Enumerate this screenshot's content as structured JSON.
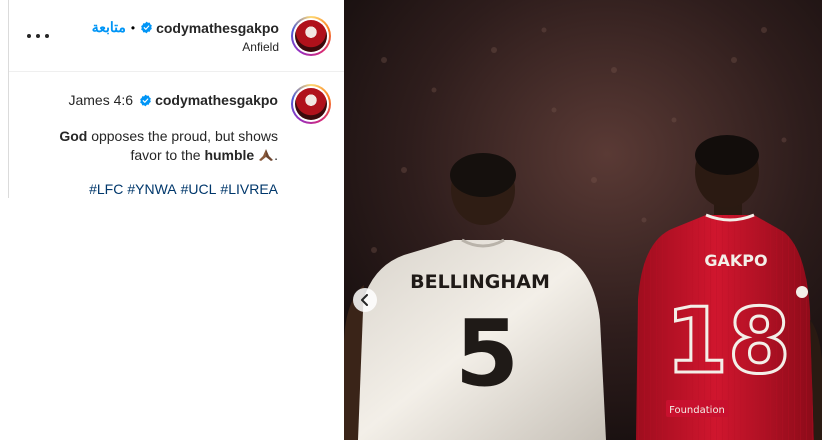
{
  "header": {
    "username": "codymathesgakpo",
    "follow_label": "متابعة",
    "separator": "•",
    "location": "Anfield"
  },
  "caption": {
    "verse": "James 4:6",
    "username": "codymathesgakpo",
    "line1_bold": "God",
    "line1_rest": " opposes the proud, but shows",
    "line2_start": "favor to the ",
    "line2_bold": "humble",
    "line2_end": ".",
    "emoji": "praying-hands-icon",
    "hashtags": [
      "#LFC",
      "#YNWA",
      "#UCL",
      "#LIVREA"
    ]
  },
  "photo": {
    "left_player_name": "BELLINGHAM",
    "left_player_number": "5",
    "right_player_name": "GAKPO",
    "right_player_number": "18",
    "sponsor": "Foundation"
  },
  "colors": {
    "accent": "#0095f6",
    "hashtag": "#00376b",
    "liverpool_red": "#c8102e",
    "madrid_white": "#f2efe9"
  }
}
